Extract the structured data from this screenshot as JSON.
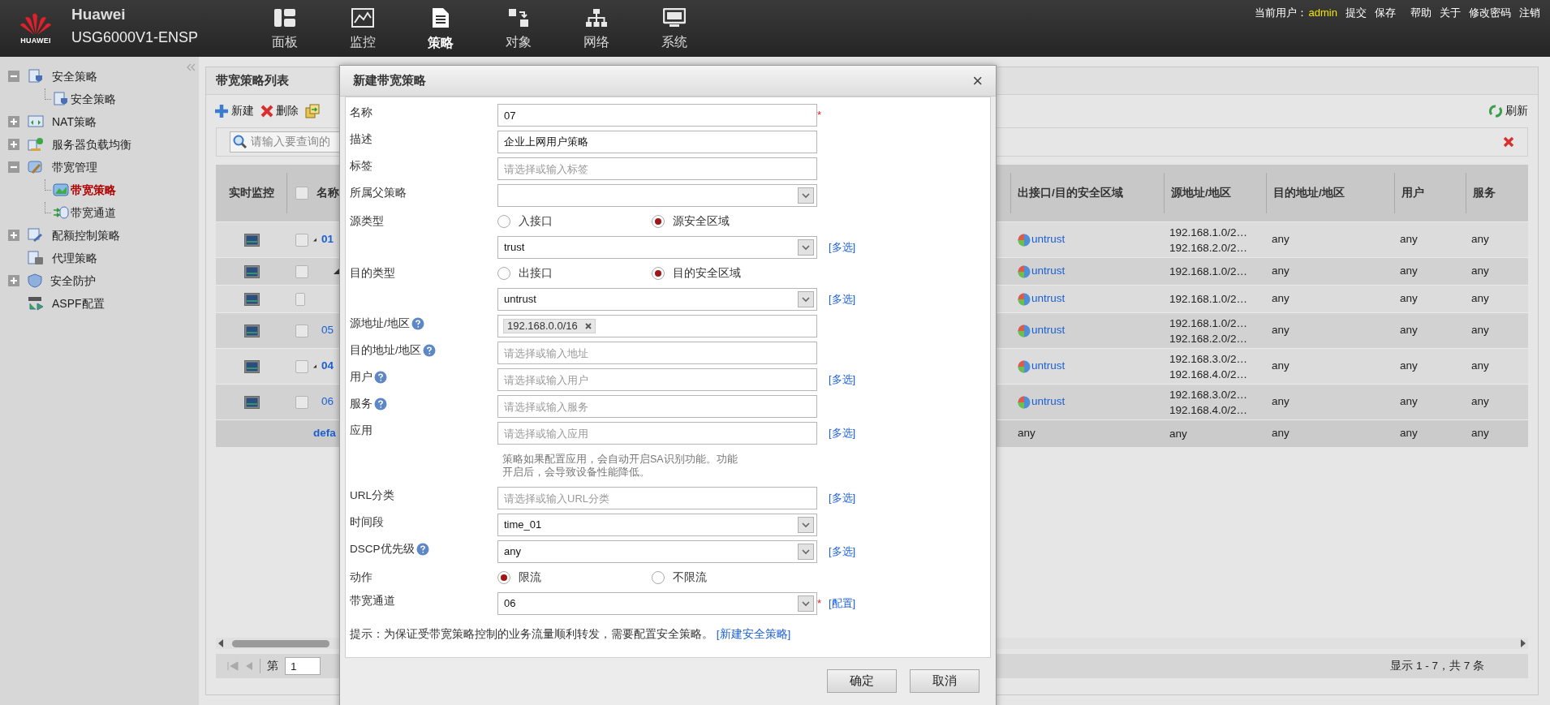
{
  "header": {
    "logo_text": "HUAWEI",
    "brand": "Huawei",
    "model": "USG6000V1-ENSP",
    "nav": [
      {
        "kind": "dashboard",
        "label": "面板",
        "selected": false
      },
      {
        "kind": "monitor",
        "label": "监控",
        "selected": false
      },
      {
        "kind": "policy",
        "label": "策略",
        "selected": true
      },
      {
        "kind": "object",
        "label": "对象",
        "selected": false
      },
      {
        "kind": "network",
        "label": "网络",
        "selected": false
      },
      {
        "kind": "system",
        "label": "系统",
        "selected": false
      }
    ],
    "user_label": "当前用户：",
    "user": "admin",
    "links": [
      "提交",
      "保存",
      "帮助",
      "关于",
      "修改密码",
      "注销"
    ]
  },
  "sidebar": {
    "items": [
      {
        "kind": "security",
        "label": "安全策略",
        "expanded": true,
        "children": [
          {
            "kind": "security",
            "label": "安全策略",
            "selected": false
          }
        ]
      },
      {
        "kind": "nat",
        "label": "NAT策略",
        "expanded": false
      },
      {
        "kind": "server",
        "label": "服务器负载均衡",
        "expanded": false
      },
      {
        "kind": "bandwidth",
        "label": "带宽管理",
        "expanded": true,
        "children": [
          {
            "kind": "chart",
            "label": "带宽策略",
            "selected": true
          },
          {
            "kind": "channel",
            "label": "带宽通道",
            "selected": false
          }
        ]
      },
      {
        "kind": "quota",
        "label": "配额控制策略",
        "expanded": false
      },
      {
        "kind": "proxy",
        "label": "代理策略"
      },
      {
        "kind": "shield",
        "label": "安全防护",
        "expanded": false
      },
      {
        "kind": "aspf",
        "label": "ASPF配置"
      }
    ]
  },
  "panel": {
    "title": "带宽策略列表",
    "toolbar": [
      {
        "kind": "add",
        "label": "新建"
      },
      {
        "kind": "delete",
        "label": "删除"
      },
      {
        "kind": "copy"
      }
    ],
    "refresh": "刷新",
    "search": {
      "placeholder": "请输入要查询的"
    },
    "table": {
      "columns": [
        "实时监控",
        "名称",
        "出接口/目的安全区域",
        "源地址/地区",
        "目的地址/地区",
        "用户",
        "服务"
      ],
      "select_all_checked": false,
      "rows": [
        {
          "kind": "policy",
          "name": "01",
          "checked": false,
          "expandable": true,
          "zone": "untrust",
          "src": [
            "192.168.1.0/2…",
            "192.168.2.0/2…"
          ],
          "dst": "any",
          "user": "any",
          "service": "any",
          "children": [
            {
              "kind": "policy",
              "checked": false,
              "expandable": true,
              "zone": "untrust",
              "src": [
                "192.168.1.0/2…"
              ],
              "dst": "any",
              "user": "any",
              "service": "any",
              "children": [
                {
                  "kind": "policy",
                  "checked": false,
                  "expandable": false,
                  "zone": "untrust",
                  "src": [
                    "192.168.1.0/2…"
                  ],
                  "dst": "any",
                  "user": "any",
                  "service": "any"
                }
              ]
            }
          ]
        },
        {
          "kind": "policy",
          "name": "05",
          "checked": false,
          "expandable": false,
          "zone": "untrust",
          "src": [
            "192.168.1.0/2…",
            "192.168.2.0/2…"
          ],
          "dst": "any",
          "user": "any",
          "service": "any"
        },
        {
          "kind": "policy",
          "name": "04",
          "checked": false,
          "expandable": true,
          "zone": "untrust",
          "src": [
            "192.168.3.0/2…",
            "192.168.4.0/2…"
          ],
          "dst": "any",
          "user": "any",
          "service": "any"
        },
        {
          "kind": "policy",
          "name": "06",
          "checked": false,
          "expandable": false,
          "zone": "untrust",
          "src": [
            "192.168.3.0/2…",
            "192.168.4.0/2…"
          ],
          "dst": "any",
          "user": "any",
          "service": "any"
        },
        {
          "kind": "default",
          "name": "defa",
          "zone": "any",
          "src": [
            "any"
          ],
          "dst": "any",
          "user": "any",
          "service": "any"
        }
      ],
      "pagination": {
        "page_label": "第",
        "page": "1",
        "summary": "显示 1 - 7，共 7 条"
      }
    }
  },
  "dialog": {
    "title": "新建带宽策略",
    "close": "×",
    "fields": [
      {
        "kind": "text",
        "label": "名称",
        "value": "07",
        "required_mark": "*",
        "help": false
      },
      {
        "kind": "text",
        "label": "描述",
        "value": "企业上网用户策略",
        "help": false
      },
      {
        "kind": "text",
        "label": "标签",
        "placeholder": "请选择或输入标签",
        "help": false
      },
      {
        "kind": "select",
        "label": "所属父策略",
        "help": false
      },
      {
        "kind": "radio",
        "label": "源类型",
        "options": [
          {
            "label": "入接口",
            "selected": false
          },
          {
            "label": "源安全区域",
            "selected": true
          }
        ]
      },
      {
        "kind": "select",
        "value": "trust",
        "link": "[多选]"
      },
      {
        "kind": "radio",
        "label": "目的类型",
        "options": [
          {
            "label": "出接口",
            "selected": false
          },
          {
            "label": "目的安全区域",
            "selected": true
          }
        ]
      },
      {
        "kind": "select",
        "value": "untrust",
        "link": "[多选]"
      },
      {
        "kind": "tags",
        "label": "源地址/地区",
        "tags": [
          "192.168.0.0/16"
        ],
        "help": true
      },
      {
        "kind": "text",
        "label": "目的地址/地区",
        "placeholder": "请选择或输入地址",
        "help": true
      },
      {
        "kind": "text",
        "label": "用户",
        "placeholder": "请选择或输入用户",
        "help": true,
        "link": "[多选]"
      },
      {
        "kind": "text",
        "label": "服务",
        "placeholder": "请选择或输入服务",
        "help": true
      },
      {
        "kind": "text",
        "label": "应用",
        "placeholder": "请选择或输入应用",
        "help": false,
        "link": "[多选]",
        "note": "策略如果配置应用，会自动开启SA识别功能。功能开启后，会导致设备性能降低。"
      },
      {
        "kind": "text",
        "label": "URL分类",
        "placeholder": "请选择或输入URL分类",
        "help": false,
        "link": "[多选]"
      },
      {
        "kind": "select",
        "label": "时间段",
        "value": "time_01",
        "help": false
      },
      {
        "kind": "select",
        "label": "DSCP优先级",
        "value": "any",
        "help": true,
        "link": "[多选]"
      },
      {
        "kind": "radio",
        "label": "动作",
        "options": [
          {
            "label": "限流",
            "selected": true
          },
          {
            "label": "不限流",
            "selected": false
          }
        ]
      },
      {
        "kind": "select",
        "label": "带宽通道",
        "value": "06",
        "required_mark": "*",
        "help": false,
        "link": "[配置]"
      }
    ],
    "hint": "提示：为保证受带宽策略控制的业务流量顺利转发，需要配置安全策略。",
    "hint_link": "[新建安全策略]",
    "buttons": [
      "确定",
      "取消"
    ]
  }
}
